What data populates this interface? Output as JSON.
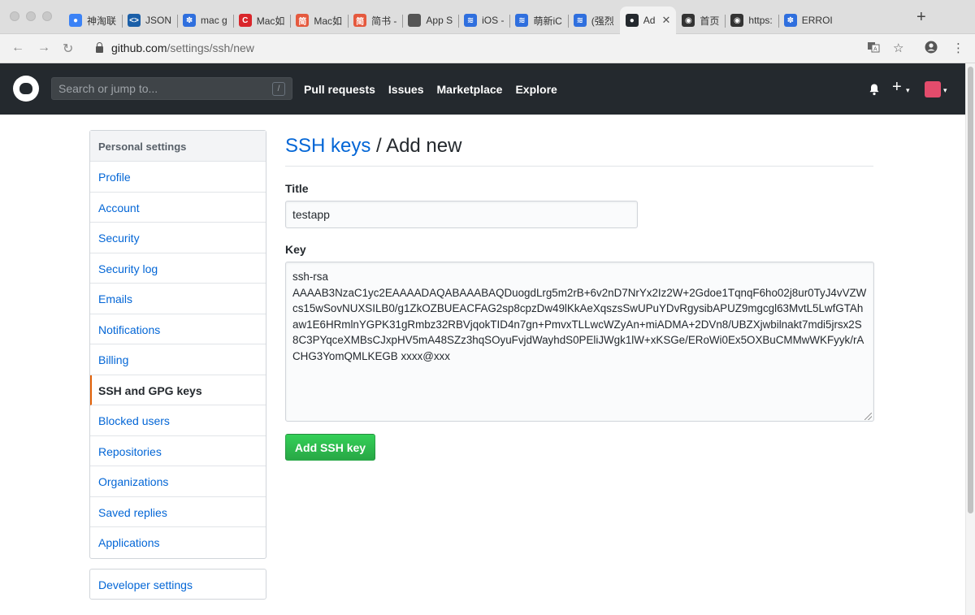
{
  "browser": {
    "tabs": [
      {
        "title": "神淘联",
        "color": "#3b82f6",
        "glyph": "●"
      },
      {
        "title": "JSON",
        "color": "#1b5fa8",
        "glyph": "<>"
      },
      {
        "title": "mac g",
        "color": "#2f6fde",
        "glyph": "✽"
      },
      {
        "title": "Mac如",
        "color": "#d9262b",
        "glyph": "C"
      },
      {
        "title": "Mac如",
        "color": "#e5593e",
        "glyph": "简"
      },
      {
        "title": "简书 -",
        "color": "#e5593e",
        "glyph": "简"
      },
      {
        "title": "App S",
        "color": "#555555",
        "glyph": ""
      },
      {
        "title": "iOS -",
        "color": "#2f6fde",
        "glyph": "≋"
      },
      {
        "title": "萌新iC",
        "color": "#2f6fde",
        "glyph": "≋"
      },
      {
        "title": "(强烈",
        "color": "#2f6fde",
        "glyph": "≋"
      },
      {
        "title": "Ad",
        "color": "#24292e",
        "glyph": "●",
        "active": true
      },
      {
        "title": "首页",
        "color": "#333333",
        "glyph": "◉"
      },
      {
        "title": "https:",
        "color": "#333333",
        "glyph": "◉"
      },
      {
        "title": "ERROI",
        "color": "#2f6fde",
        "glyph": "✽"
      }
    ],
    "url_host": "github.com",
    "url_path": "/settings/ssh/new"
  },
  "header": {
    "search_placeholder": "Search or jump to...",
    "search_shortcut": "/",
    "nav": [
      "Pull requests",
      "Issues",
      "Marketplace",
      "Explore"
    ]
  },
  "sidebar": {
    "heading": "Personal settings",
    "items": [
      {
        "label": "Profile"
      },
      {
        "label": "Account"
      },
      {
        "label": "Security"
      },
      {
        "label": "Security log"
      },
      {
        "label": "Emails"
      },
      {
        "label": "Notifications"
      },
      {
        "label": "Billing"
      },
      {
        "label": "SSH and GPG keys",
        "selected": true
      },
      {
        "label": "Blocked users"
      },
      {
        "label": "Repositories"
      },
      {
        "label": "Organizations"
      },
      {
        "label": "Saved replies"
      },
      {
        "label": "Applications"
      }
    ],
    "developer": "Developer settings"
  },
  "main": {
    "breadcrumb": "SSH keys",
    "separator": " / ",
    "title": "Add new",
    "title_label": "Title",
    "title_value": "testapp",
    "key_label": "Key",
    "key_value": "ssh-rsa\nAAAAB3NzaC1yc2EAAAADAQABAAABAQDuogdLrg5m2rB+6v2nD7NrYx2Iz2W+2Gdoe1TqnqF6ho02j8ur0TyJ4vVZWcs15wSovNUXSILB0/g1ZkOZBUEACFAG2sp8cpzDw49lKkAeXqszsSwUPuYDvRgysibAPUZ9mgcgl63MvtL5LwfGTAhaw1E6HRmlnYGPK31gRmbz32RBVjqokTID4n7gn+PmvxTLLwcWZyAn+miADMA+2DVn8/UBZXjwbilnakt7mdi5jrsx2S8C3PYqceXMBsCJxpHV5mA48SZz3hqSOyuFvjdWayhdS0PEliJWgk1lW+xKSGe/ERoWi0Ex5OXBuCMMwWKFyyk/rACHG3YomQMLKEGB xxxx@xxx",
    "submit": "Add SSH key"
  },
  "colors": {
    "header_bg": "#24292e",
    "link": "#0366d6",
    "selected_border": "#e36209",
    "button_green": "#28a745"
  }
}
